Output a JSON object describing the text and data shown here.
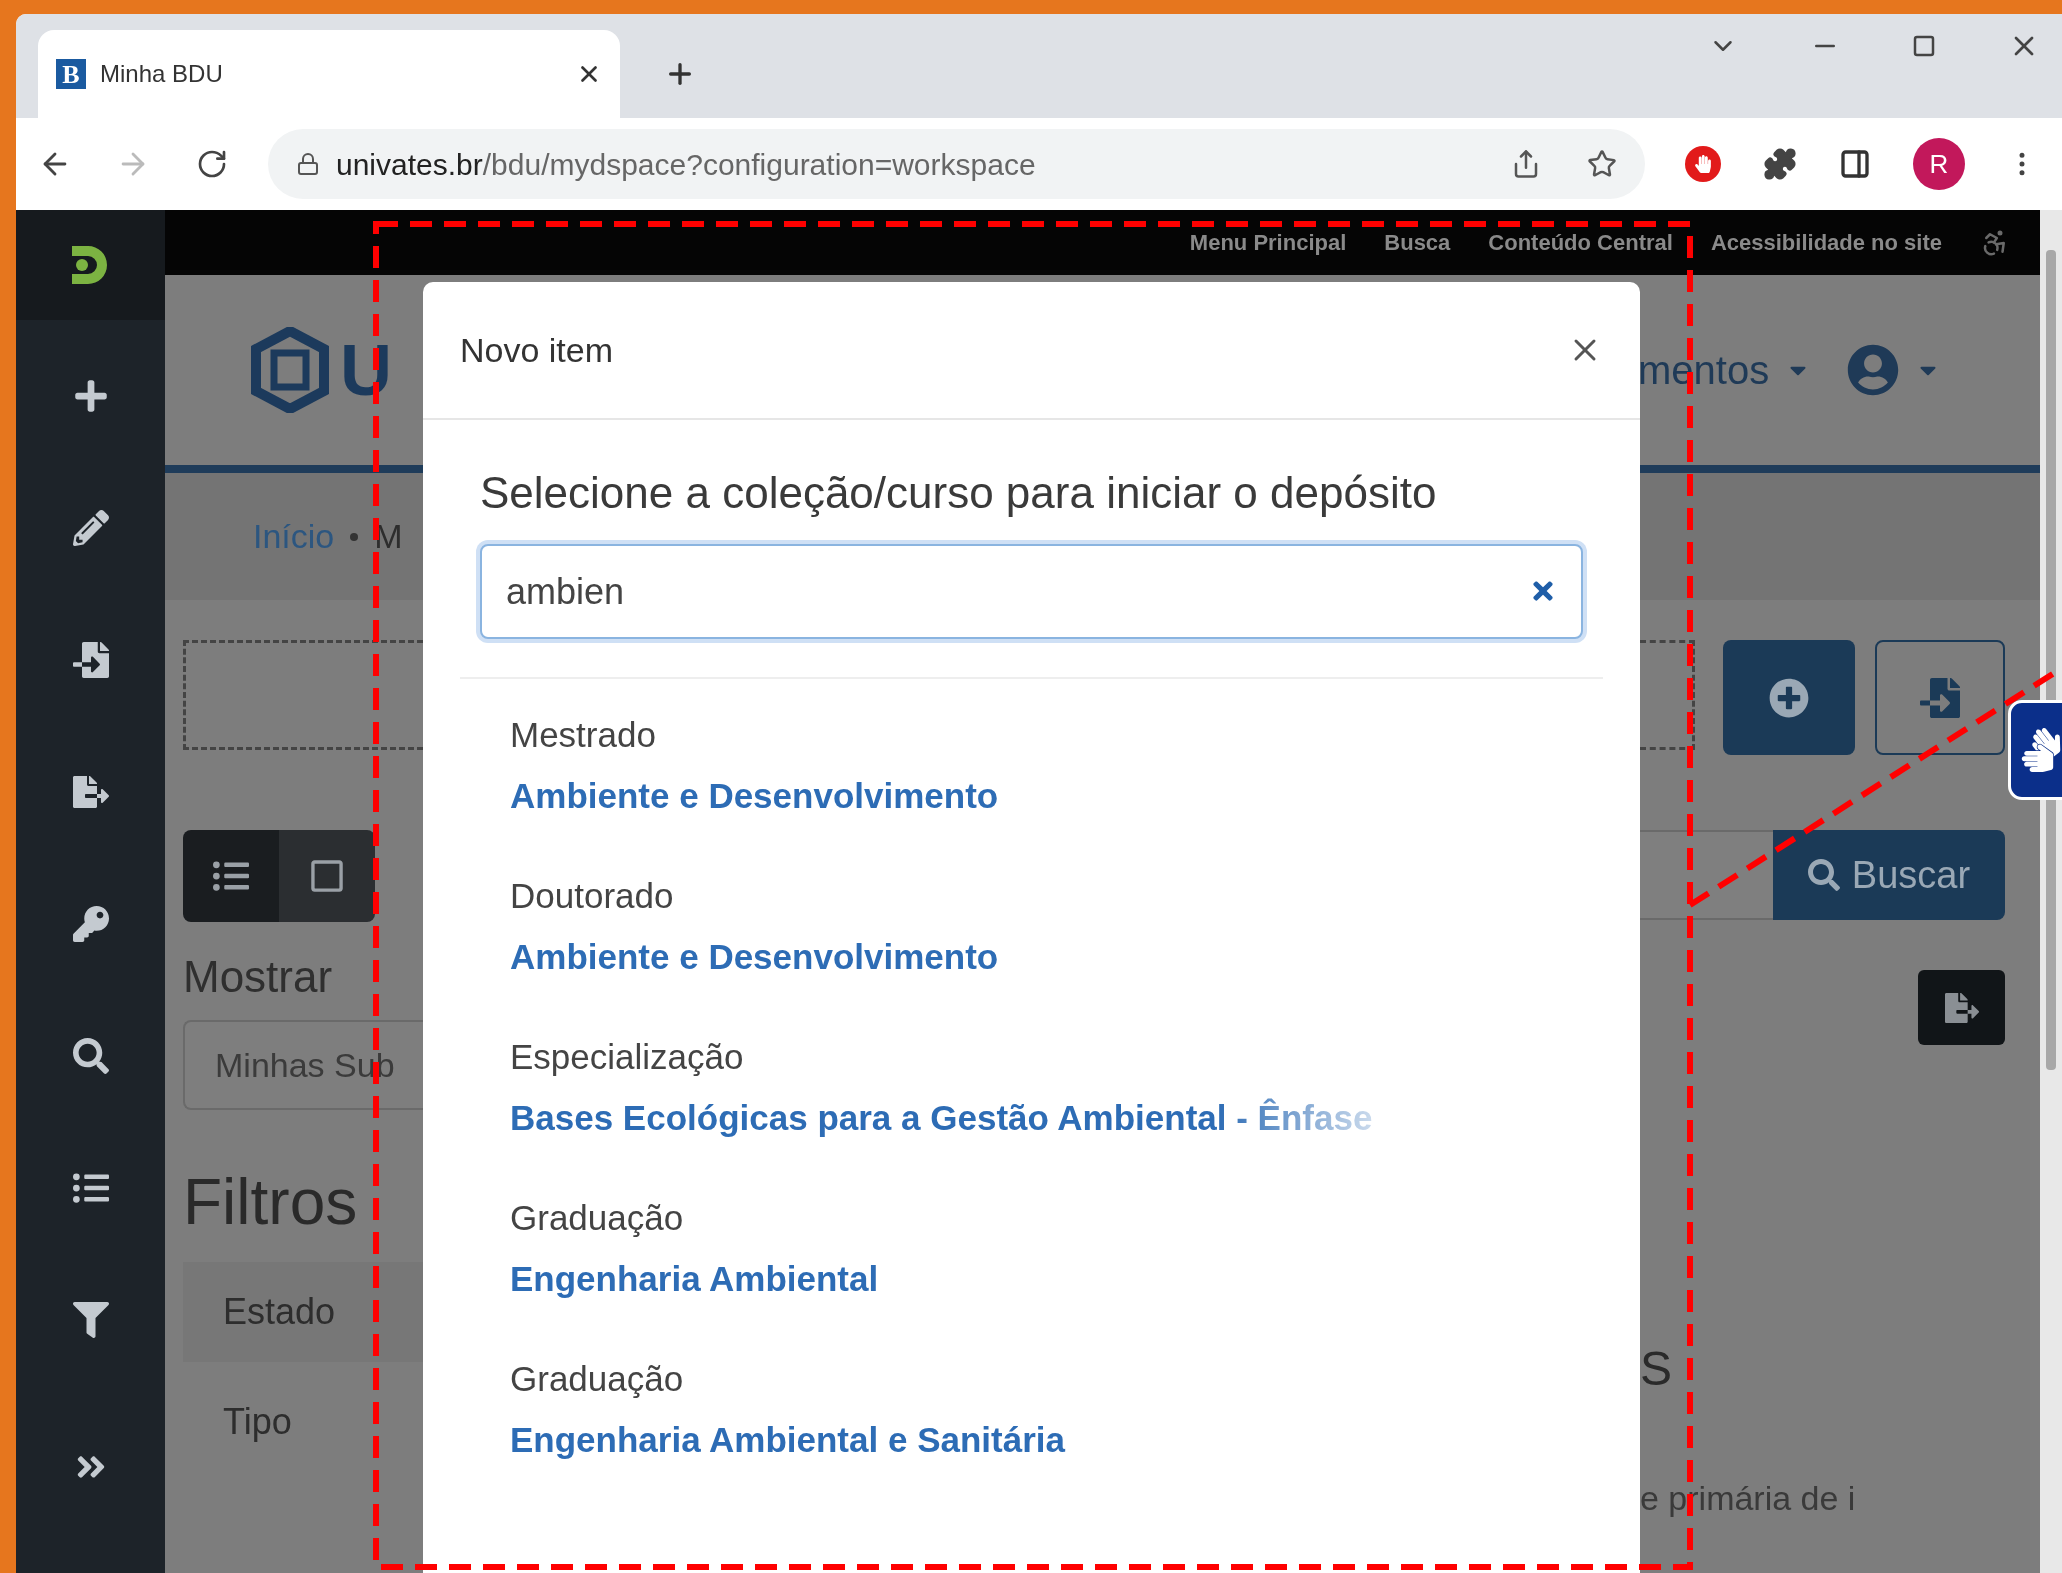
{
  "browser": {
    "tab": {
      "favicon_letter": "B",
      "title": "Minha BDU"
    },
    "url": {
      "host": "univates.br",
      "path": "/bdu/mydspace?configuration=workspace"
    },
    "profile_initial": "R"
  },
  "top_links": [
    "Menu Principal",
    "Busca",
    "Conteúdo Central",
    "Acessibilidade no site"
  ],
  "page": {
    "brand_fragment": "U",
    "menu_fragment": "mentos",
    "breadcrumb": [
      "Início",
      "M"
    ],
    "view_toggle": [
      {
        "kind": "list",
        "selected": true
      },
      {
        "kind": "grid",
        "selected": false
      }
    ],
    "show_label": "Mostrar",
    "show_select": "Minhas Sub",
    "filters_title": "Filtros",
    "filters": [
      "Estado",
      "Tipo"
    ],
    "search_button": "Buscar",
    "fragment_heading": "S",
    "fragment_text": "e primária de i"
  },
  "modal": {
    "title": "Novo item",
    "heading": "Selecione a coleção/curso para iniciar o depósito",
    "search_value": "ambien",
    "results": [
      {
        "category": "Mestrado",
        "name": "Ambiente e Desenvolvimento",
        "faded": false
      },
      {
        "category": "Doutorado",
        "name": "Ambiente e Desenvolvimento",
        "faded": false
      },
      {
        "category": "Especialização",
        "name": "Bases Ecológicas para a Gestão Ambiental - Ênfase",
        "faded": true
      },
      {
        "category": "Graduação",
        "name": "Engenharia Ambiental",
        "faded": false
      },
      {
        "category": "Graduação",
        "name": "Engenharia Ambiental e Sanitária",
        "faded": false
      }
    ]
  }
}
